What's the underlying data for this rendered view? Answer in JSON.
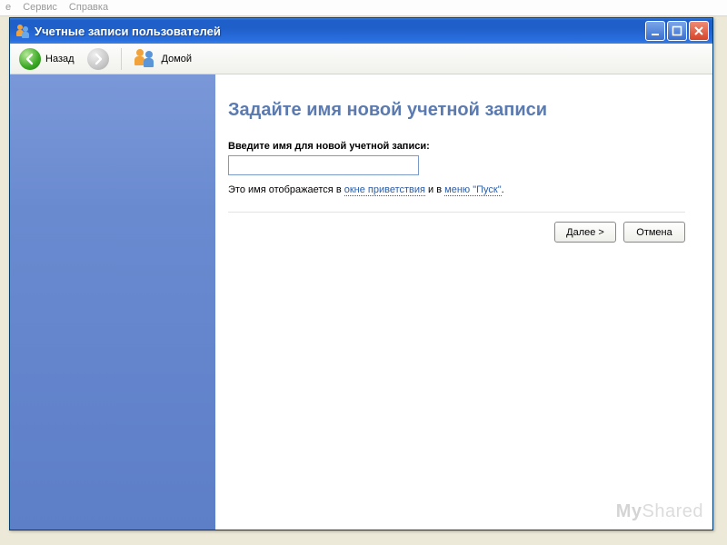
{
  "parent_menu": {
    "item1": "е",
    "item2": "Сервис",
    "item3": "Справка"
  },
  "window": {
    "title": "Учетные записи пользователей",
    "toolbar": {
      "back": "Назад",
      "home": "Домой"
    }
  },
  "page": {
    "heading": "Задайте имя новой учетной записи",
    "instruction": "Введите имя для новой учетной записи:",
    "hint_prefix": "Это имя отображается в ",
    "link_welcome": "окне приветствия",
    "hint_mid": " и в ",
    "link_start": "меню \"Пуск\"",
    "hint_suffix": "."
  },
  "buttons": {
    "next": "Далее >",
    "cancel": "Отмена"
  },
  "watermark": {
    "a": "My",
    "b": "Shared"
  }
}
